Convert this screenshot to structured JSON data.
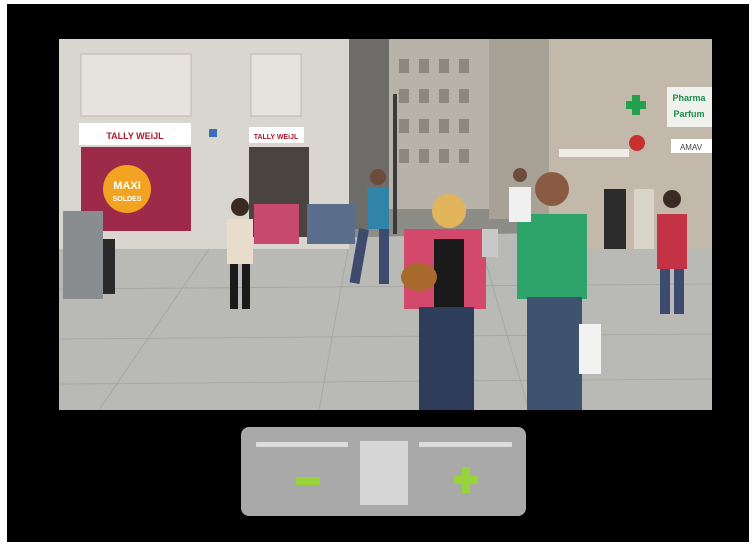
{
  "video": {
    "scene_signs": {
      "left_store": "TALLY WEiJL",
      "left_store_2": "TALLY WEiJL",
      "sale_poster_1": "MAXI",
      "sale_poster_2": "SOLDES",
      "pharmacy": "Pharma",
      "pharmacy_2": "Parfum",
      "right_store": "AMAV"
    }
  },
  "zoom_control": {
    "minus_icon": "minus-icon",
    "plus_icon": "plus-icon",
    "accent_color": "#99d33a",
    "panel_color": "#a9a9a9"
  }
}
